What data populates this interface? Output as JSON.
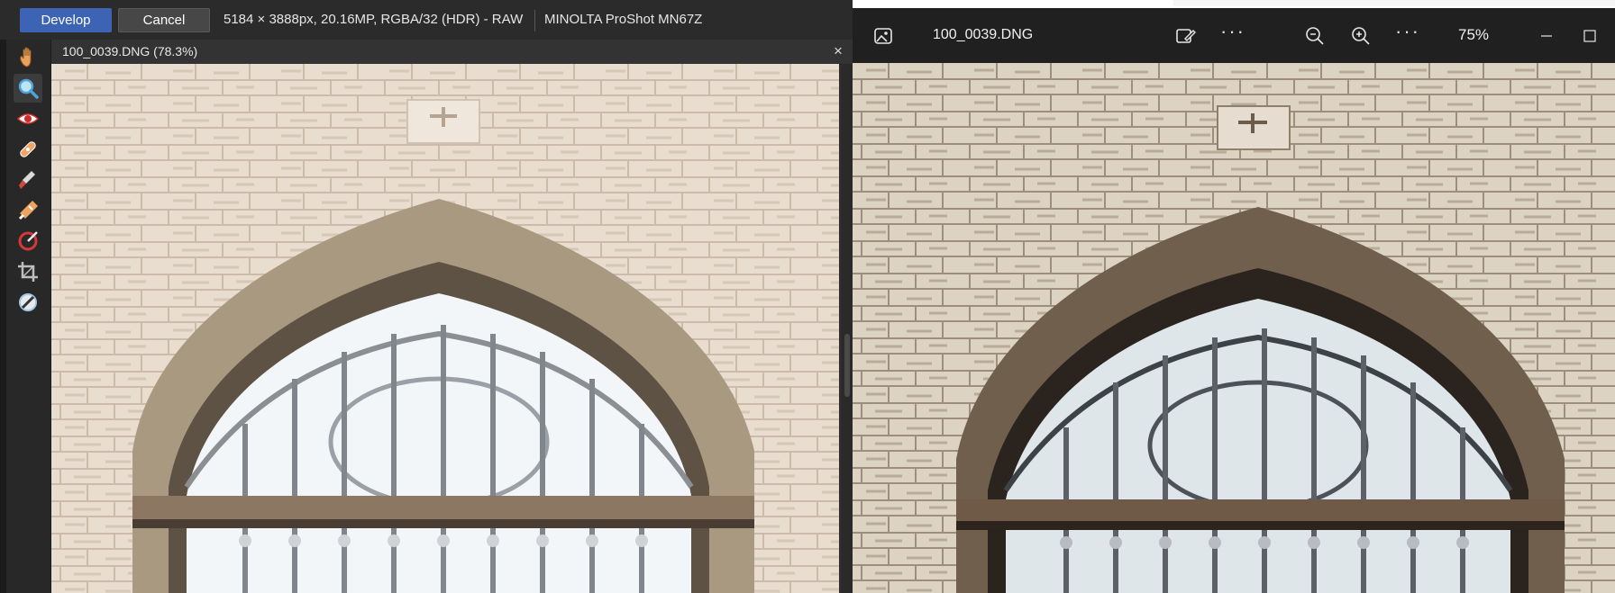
{
  "editor": {
    "develop_label": "Develop",
    "cancel_label": "Cancel",
    "image_info": "5184 × 3888px, 20.16MP, RGBA/32 (HDR) - RAW",
    "camera_model": "MINOLTA ProShot MN67Z",
    "document_tab": "100_0039.DNG (78.3%)",
    "close_glyph": "×",
    "tools": [
      "hand-tool",
      "zoom-tool",
      "red-eye-tool",
      "blemish-removal-tool",
      "clone-brush-tool",
      "retouch-brush-tool",
      "overlay-gradient-tool",
      "crop-tool",
      "white-balance-picker-tool"
    ],
    "active_tool": "zoom-tool",
    "accent_color": "#3d63b5"
  },
  "viewer": {
    "filename": "100_0039.DNG",
    "zoom": "75%",
    "more_glyph": "···",
    "icons": [
      "gallery-icon",
      "edit-image-icon",
      "more-options-icon",
      "zoom-out-icon",
      "zoom-in-icon",
      "more-options-icon",
      "minimize-icon",
      "maximize-icon"
    ]
  }
}
